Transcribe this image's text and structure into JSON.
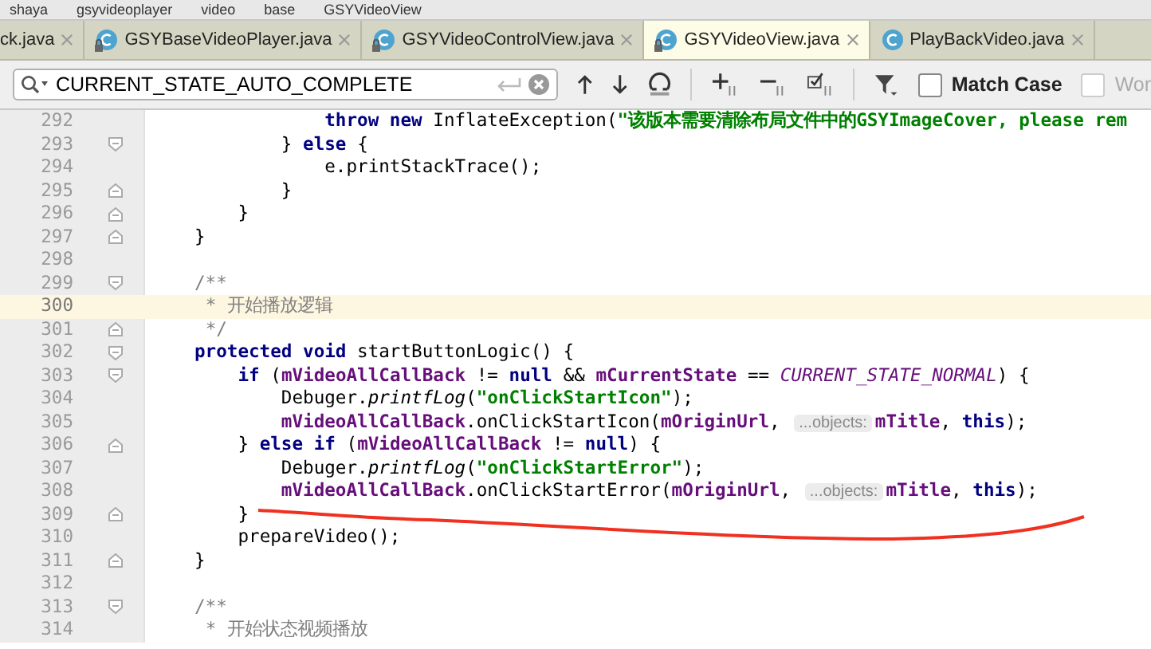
{
  "breadcrumbs": [
    "shaya",
    "gsyvideoplayer",
    "video",
    "base",
    "GSYVideoView"
  ],
  "tabs": [
    {
      "label": "ck.java",
      "selected": false
    },
    {
      "label": "GSYBaseVideoPlayer.java",
      "selected": false,
      "icon": {
        "locked": true
      }
    },
    {
      "label": "GSYVideoControlView.java",
      "selected": false,
      "icon": {
        "locked": true
      }
    },
    {
      "label": "GSYVideoView.java",
      "selected": true,
      "icon": {
        "locked": true
      }
    },
    {
      "label": "PlayBackVideo.java",
      "selected": false,
      "icon": {
        "locked": false
      }
    }
  ],
  "find_bar": {
    "value": "CURRENT_STATE_AUTO_COMPLETE",
    "options": [
      {
        "label": "Match Case",
        "checked": false,
        "disabled": false
      },
      {
        "label": "Wor",
        "checked": false,
        "disabled": true
      }
    ]
  },
  "editor": {
    "lines": [
      {
        "number": "292",
        "current": false,
        "fold_start": false,
        "fold_end": false,
        "tokens": [
          {
            "kind": "keyword",
            "text": "            throw new "
          },
          {
            "kind": "plain",
            "text": "InflateException("
          },
          {
            "kind": "string",
            "text": "\"该版本需要清除布局文件中的GSYImageCover, please rem"
          }
        ]
      },
      {
        "number": "293",
        "current": false,
        "fold_start": true,
        "fold_end": false,
        "tokens": [
          {
            "kind": "plain",
            "text": "        } "
          },
          {
            "kind": "keyword",
            "text": "else"
          },
          {
            "kind": "plain",
            "text": " {"
          }
        ]
      },
      {
        "number": "294",
        "current": false,
        "fold_start": false,
        "fold_end": false,
        "tokens": [
          {
            "kind": "plain",
            "text": "            e.printStackTrace();"
          }
        ]
      },
      {
        "number": "295",
        "current": false,
        "fold_start": false,
        "fold_end": true,
        "tokens": [
          {
            "kind": "plain",
            "text": "        }"
          }
        ]
      },
      {
        "number": "296",
        "current": false,
        "fold_start": false,
        "fold_end": true,
        "tokens": [
          {
            "kind": "plain",
            "text": "    }"
          }
        ]
      },
      {
        "number": "297",
        "current": false,
        "fold_start": false,
        "fold_end": true,
        "tokens": [
          {
            "kind": "plain",
            "text": "}"
          }
        ]
      },
      {
        "number": "298",
        "current": false,
        "fold_start": false,
        "fold_end": false
      },
      {
        "number": "299",
        "current": false,
        "fold_start": true,
        "fold_end": false,
        "tokens": [
          {
            "kind": "comment",
            "text": "/**"
          }
        ]
      },
      {
        "number": "300",
        "current": true,
        "fold_start": false,
        "fold_end": false,
        "tokens": [
          {
            "kind": "comment",
            "text": " * 开始播放逻辑"
          }
        ]
      },
      {
        "number": "301",
        "current": false,
        "fold_start": false,
        "fold_end": true,
        "tokens": [
          {
            "kind": "comment",
            "text": " */"
          }
        ]
      },
      {
        "number": "302",
        "current": false,
        "fold_start": true,
        "fold_end": false,
        "tokens": [
          {
            "kind": "keyword",
            "text": "protected void "
          },
          {
            "kind": "plain",
            "text": "startButtonLogic() {"
          }
        ]
      },
      {
        "number": "303",
        "current": false,
        "fold_start": true,
        "fold_end": false,
        "tokens": [
          {
            "kind": "keyword",
            "text": "    if "
          },
          {
            "kind": "plain",
            "text": "("
          },
          {
            "kind": "field",
            "text": "mVideoAllCallBack"
          },
          {
            "kind": "plain",
            "text": " != "
          },
          {
            "kind": "keyword",
            "text": "null"
          },
          {
            "kind": "plain",
            "text": " && "
          },
          {
            "kind": "field",
            "text": "mCurrentState"
          },
          {
            "kind": "plain",
            "text": " == "
          },
          {
            "kind": "constant",
            "text": "CURRENT_STATE_NORMAL"
          },
          {
            "kind": "plain",
            "text": ") {"
          }
        ]
      },
      {
        "number": "304",
        "current": false,
        "fold_start": false,
        "fold_end": false,
        "tokens": [
          {
            "kind": "plain",
            "text": "        Debuger."
          },
          {
            "kind": "static",
            "text": "printfLog"
          },
          {
            "kind": "plain",
            "text": "("
          },
          {
            "kind": "string",
            "text": "\"onClickStartIcon\""
          },
          {
            "kind": "plain",
            "text": ");"
          }
        ]
      },
      {
        "number": "305",
        "current": false,
        "fold_start": false,
        "fold_end": false,
        "tokens": [
          {
            "kind": "field",
            "text": "        mVideoAllCallBack"
          },
          {
            "kind": "plain",
            "text": ".onClickStartIcon("
          },
          {
            "kind": "field",
            "text": "mOriginUrl"
          },
          {
            "kind": "plain",
            "text": ", "
          },
          {
            "kind": "hint",
            "text": "...objects:"
          },
          {
            "kind": "field",
            "text": "mTitle"
          },
          {
            "kind": "plain",
            "text": ", "
          },
          {
            "kind": "keyword",
            "text": "this"
          },
          {
            "kind": "plain",
            "text": ");"
          }
        ]
      },
      {
        "number": "306",
        "current": false,
        "fold_start": false,
        "fold_end": true,
        "tokens": [
          {
            "kind": "plain",
            "text": "    } "
          },
          {
            "kind": "keyword",
            "text": "else if "
          },
          {
            "kind": "plain",
            "text": "("
          },
          {
            "kind": "field",
            "text": "mVideoAllCallBack"
          },
          {
            "kind": "plain",
            "text": " != "
          },
          {
            "kind": "keyword",
            "text": "null"
          },
          {
            "kind": "plain",
            "text": ") {"
          }
        ]
      },
      {
        "number": "307",
        "current": false,
        "fold_start": false,
        "fold_end": false,
        "tokens": [
          {
            "kind": "plain",
            "text": "        Debuger."
          },
          {
            "kind": "static",
            "text": "printfLog"
          },
          {
            "kind": "plain",
            "text": "("
          },
          {
            "kind": "string",
            "text": "\"onClickStartError\""
          },
          {
            "kind": "plain",
            "text": ");"
          }
        ]
      },
      {
        "number": "308",
        "current": false,
        "fold_start": false,
        "fold_end": false,
        "tokens": [
          {
            "kind": "field",
            "text": "        mVideoAllCallBack"
          },
          {
            "kind": "plain",
            "text": ".onClickStartError("
          },
          {
            "kind": "field",
            "text": "mOriginUrl"
          },
          {
            "kind": "plain",
            "text": ", "
          },
          {
            "kind": "hint",
            "text": "...objects:"
          },
          {
            "kind": "field",
            "text": "mTitle"
          },
          {
            "kind": "plain",
            "text": ", "
          },
          {
            "kind": "keyword",
            "text": "this"
          },
          {
            "kind": "plain",
            "text": ");"
          }
        ]
      },
      {
        "number": "309",
        "current": false,
        "fold_start": false,
        "fold_end": true,
        "tokens": [
          {
            "kind": "plain",
            "text": "    }"
          }
        ]
      },
      {
        "number": "310",
        "current": false,
        "fold_start": false,
        "fold_end": false,
        "tokens": [
          {
            "kind": "plain",
            "text": "    prepareVideo();"
          }
        ]
      },
      {
        "number": "311",
        "current": false,
        "fold_start": false,
        "fold_end": true,
        "tokens": [
          {
            "kind": "plain",
            "text": "}"
          }
        ]
      },
      {
        "number": "312",
        "current": false,
        "fold_start": false,
        "fold_end": false
      },
      {
        "number": "313",
        "current": false,
        "fold_start": true,
        "fold_end": false,
        "tokens": [
          {
            "kind": "comment",
            "text": "/**"
          }
        ]
      },
      {
        "number": "314",
        "current": false,
        "fold_start": false,
        "fold_end": false,
        "tokens": [
          {
            "kind": "comment",
            "text": " * 开始状态视频播放"
          }
        ]
      }
    ]
  }
}
